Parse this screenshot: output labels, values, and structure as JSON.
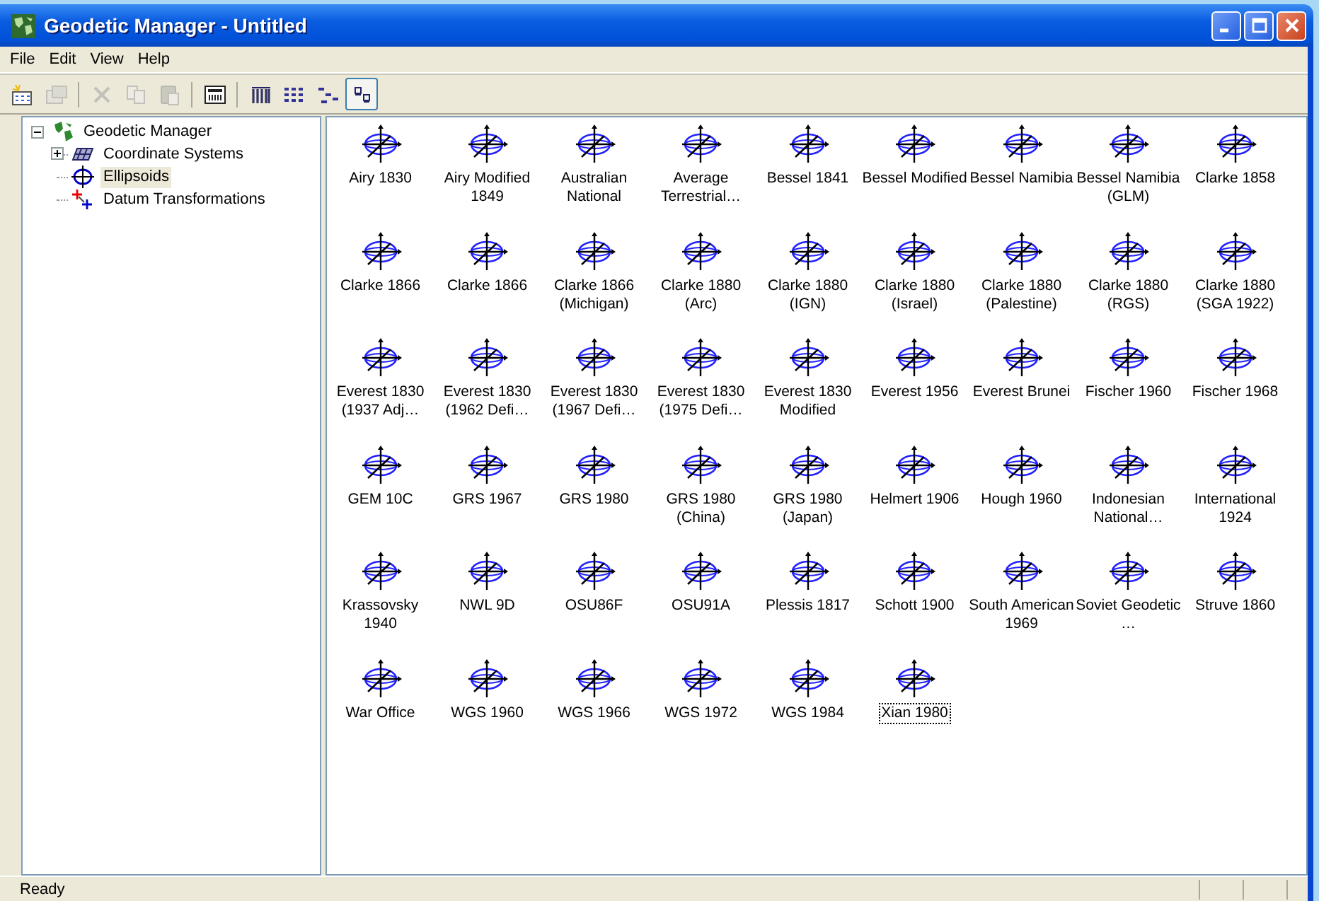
{
  "window": {
    "title": "Geodetic Manager - Untitled"
  },
  "menu": [
    "File",
    "Edit",
    "View",
    "Help"
  ],
  "toolbar": [
    {
      "kind": "new",
      "disabled": false,
      "pressed": false
    },
    {
      "kind": "properties",
      "disabled": true,
      "pressed": false
    },
    {
      "kind": "delete",
      "disabled": true,
      "pressed": false
    },
    {
      "kind": "copy",
      "disabled": true,
      "pressed": false
    },
    {
      "kind": "paste",
      "disabled": true,
      "pressed": false
    },
    {
      "kind": "calculator",
      "disabled": false,
      "pressed": false
    },
    {
      "kind": "large-icons",
      "disabled": false,
      "pressed": false
    },
    {
      "kind": "list",
      "disabled": false,
      "pressed": false
    },
    {
      "kind": "tree",
      "disabled": false,
      "pressed": false
    },
    {
      "kind": "small-icons",
      "disabled": false,
      "pressed": true
    }
  ],
  "tree": [
    {
      "label": "Geodetic Manager",
      "kind": "globe",
      "expanded": true,
      "selected": false,
      "children": [
        {
          "label": "Coordinate Systems",
          "kind": "grid",
          "expanded": false,
          "selected": false
        },
        {
          "label": "Ellipsoids",
          "kind": "ellipsoid",
          "selected": true
        },
        {
          "label": "Datum Transformations",
          "kind": "transform",
          "selected": false
        }
      ]
    }
  ],
  "items": [
    {
      "label": "Airy 1830",
      "selected": false
    },
    {
      "label": "Airy Modified 1849",
      "selected": false
    },
    {
      "label": "Australian National",
      "selected": false
    },
    {
      "label": "Average Terrestrial…",
      "selected": false
    },
    {
      "label": "Bessel 1841",
      "selected": false
    },
    {
      "label": "Bessel Modified",
      "selected": false
    },
    {
      "label": "Bessel Namibia",
      "selected": false
    },
    {
      "label": "Bessel Namibia (GLM)",
      "selected": false
    },
    {
      "label": "Clarke 1858",
      "selected": false
    },
    {
      "label": "Clarke 1866",
      "selected": false
    },
    {
      "label": "Clarke 1866",
      "selected": false
    },
    {
      "label": "Clarke 1866 (Michigan)",
      "selected": false
    },
    {
      "label": "Clarke 1880 (Arc)",
      "selected": false
    },
    {
      "label": "Clarke 1880 (IGN)",
      "selected": false
    },
    {
      "label": "Clarke 1880 (Israel)",
      "selected": false
    },
    {
      "label": "Clarke 1880 (Palestine)",
      "selected": false
    },
    {
      "label": "Clarke 1880 (RGS)",
      "selected": false
    },
    {
      "label": "Clarke 1880 (SGA 1922)",
      "selected": false
    },
    {
      "label": "Everest 1830 (1937 Adj…",
      "selected": false
    },
    {
      "label": "Everest 1830 (1962 Defi…",
      "selected": false
    },
    {
      "label": "Everest 1830 (1967 Defi…",
      "selected": false
    },
    {
      "label": "Everest 1830 (1975 Defi…",
      "selected": false
    },
    {
      "label": "Everest 1830 Modified",
      "selected": false
    },
    {
      "label": "Everest 1956",
      "selected": false
    },
    {
      "label": "Everest Brunei",
      "selected": false
    },
    {
      "label": "Fischer 1960",
      "selected": false
    },
    {
      "label": "Fischer 1968",
      "selected": false
    },
    {
      "label": "GEM 10C",
      "selected": false
    },
    {
      "label": "GRS 1967",
      "selected": false
    },
    {
      "label": "GRS 1980",
      "selected": false
    },
    {
      "label": "GRS 1980 (China)",
      "selected": false
    },
    {
      "label": "GRS 1980 (Japan)",
      "selected": false
    },
    {
      "label": "Helmert 1906",
      "selected": false
    },
    {
      "label": "Hough 1960",
      "selected": false
    },
    {
      "label": "Indonesian National…",
      "selected": false
    },
    {
      "label": "International 1924",
      "selected": false
    },
    {
      "label": "Krassovsky 1940",
      "selected": false
    },
    {
      "label": "NWL 9D",
      "selected": false
    },
    {
      "label": "OSU86F",
      "selected": false
    },
    {
      "label": "OSU91A",
      "selected": false
    },
    {
      "label": "Plessis 1817",
      "selected": false
    },
    {
      "label": "Schott 1900",
      "selected": false
    },
    {
      "label": "South American 1969",
      "selected": false
    },
    {
      "label": "Soviet Geodetic …",
      "selected": false
    },
    {
      "label": "Struve 1860",
      "selected": false
    },
    {
      "label": "War Office",
      "selected": false
    },
    {
      "label": "WGS 1960",
      "selected": false
    },
    {
      "label": "WGS 1966",
      "selected": false
    },
    {
      "label": "WGS 1972",
      "selected": false
    },
    {
      "label": "WGS 1984",
      "selected": false
    },
    {
      "label": "Xian 1980",
      "selected": true
    }
  ],
  "status_bar": {
    "text": "Ready"
  }
}
